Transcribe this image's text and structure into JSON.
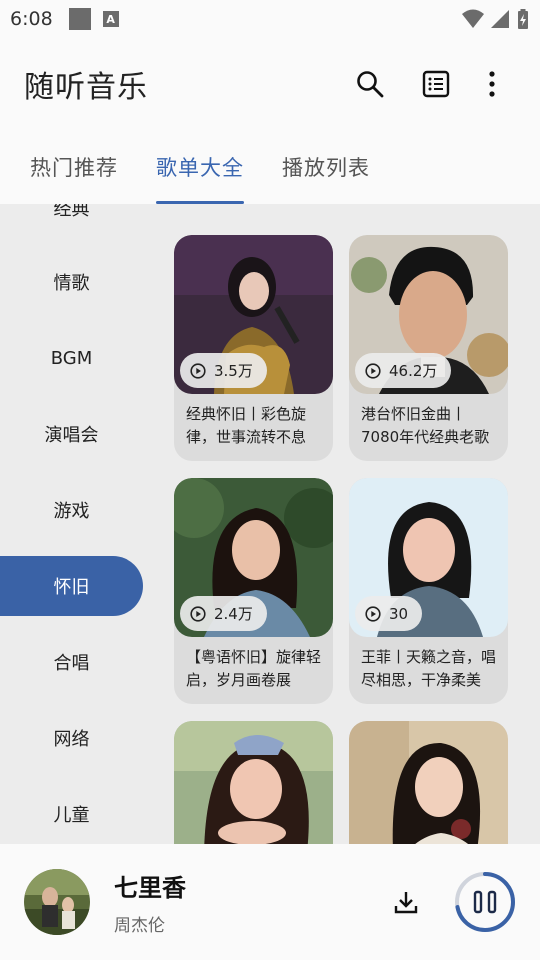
{
  "status_bar": {
    "time": "6:08",
    "notification_letter": "A"
  },
  "app_bar": {
    "title": "随听音乐",
    "actions": [
      "search-icon",
      "list-icon",
      "more-vert-icon"
    ]
  },
  "tabs": [
    {
      "label": "热门推荐",
      "active": false
    },
    {
      "label": "歌单大全",
      "active": true
    },
    {
      "label": "播放列表",
      "active": false
    }
  ],
  "categories": [
    {
      "label": "经典",
      "active": false
    },
    {
      "label": "情歌",
      "active": false
    },
    {
      "label": "BGM",
      "active": false
    },
    {
      "label": "演唱会",
      "active": false
    },
    {
      "label": "游戏",
      "active": false
    },
    {
      "label": "怀旧",
      "active": true
    },
    {
      "label": "合唱",
      "active": false
    },
    {
      "label": "网络",
      "active": false
    },
    {
      "label": "儿童",
      "active": false
    }
  ],
  "playlists": [
    {
      "plays": "3.5万",
      "title": "经典怀旧丨彩色旋律，世事流转不息"
    },
    {
      "plays": "46.2万",
      "title": "港台怀旧金曲丨7080年代经典老歌"
    },
    {
      "plays": "2.4万",
      "title": "【粤语怀旧】旋律轻启，岁月画卷展"
    },
    {
      "plays": "30",
      "title": "王菲丨天籁之音，唱尽相思，干净柔美"
    },
    {
      "plays": "",
      "title": ""
    },
    {
      "plays": "",
      "title": ""
    }
  ],
  "player": {
    "song_title": "七里香",
    "artist": "周杰伦",
    "progress": 0.72
  },
  "colors": {
    "accent": "#3a62a6",
    "tab_active": "#3a66b0",
    "content_bg": "#ececec"
  }
}
